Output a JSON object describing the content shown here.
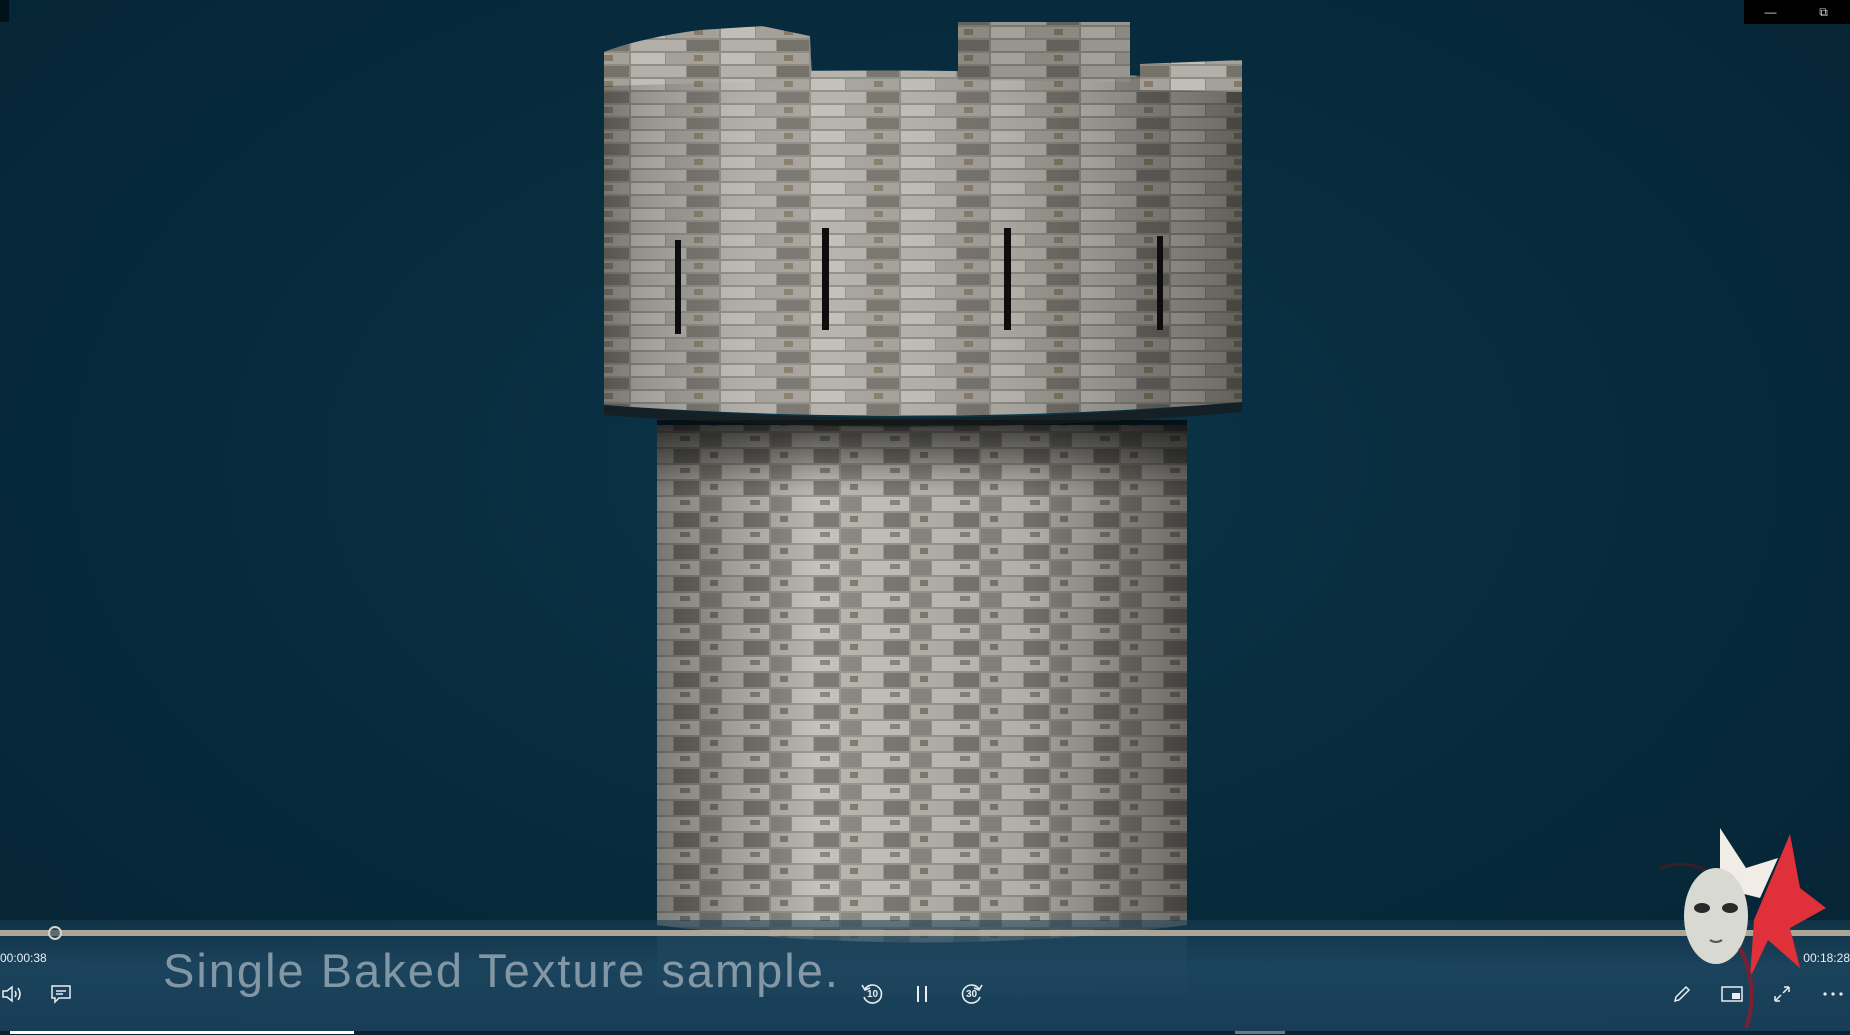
{
  "window": {
    "minimize_glyph": "—",
    "restore_glyph": "⧉"
  },
  "video": {
    "subtitle": "Single Baked Texture sample.",
    "time_elapsed": "00:00:38",
    "time_total": "00:18:28",
    "progress_fraction": 0.034,
    "skip_back_seconds": "10",
    "skip_forward_seconds": "30"
  },
  "icons": {
    "volume": "volume-icon",
    "captions": "captions-icon",
    "skip_back": "skip-back-10-icon",
    "pause": "pause-icon",
    "skip_forward": "skip-forward-30-icon",
    "edit": "pencil-icon",
    "mini_view": "mini-view-icon",
    "fullscreen": "fullscreen-icon",
    "more": "more-icon"
  },
  "colors": {
    "background": "#06283a",
    "stone_light": "#b9b7b0",
    "stone_dark": "#4d4b47",
    "seek_track": "#c7b8a4"
  }
}
